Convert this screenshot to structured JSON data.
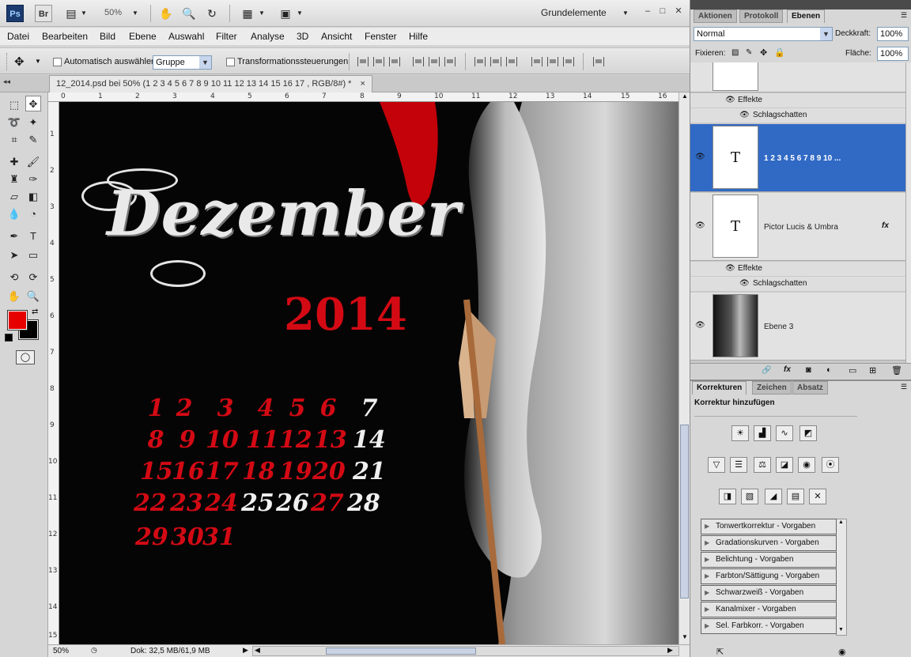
{
  "appbar": {
    "ps_logo": "Ps",
    "br_logo": "Br",
    "zoom": "50%",
    "workspace": "Grundelemente"
  },
  "menu": {
    "items": [
      "Datei",
      "Bearbeiten",
      "Bild",
      "Ebene",
      "Auswahl",
      "Filter",
      "Analyse",
      "3D",
      "Ansicht",
      "Fenster",
      "Hilfe"
    ]
  },
  "options": {
    "auto_select_label": "Automatisch auswählen:",
    "auto_select_value": "Gruppe",
    "transform_label": "Transformationssteuerungen"
  },
  "document": {
    "tab_title": "12_2014.psd bei 50% (1  2   3  4  5  6   7  8  9  10   11  12  13  14  15  16  17 , RGB/8#) *",
    "close": "×"
  },
  "ruler": {
    "top_ticks": [
      "0",
      "1",
      "2",
      "3",
      "4",
      "5",
      "6",
      "7",
      "8",
      "9",
      "10",
      "11",
      "12",
      "13",
      "14",
      "15",
      "16"
    ],
    "left_ticks": [
      "1",
      "2",
      "3",
      "4",
      "5",
      "6",
      "7",
      "8",
      "9",
      "10",
      "11",
      "12",
      "13",
      "14",
      "15"
    ]
  },
  "canvas": {
    "month": "Dezember",
    "year": "2014",
    "days": [
      [
        "1",
        "2",
        "3",
        "4",
        "5",
        "6",
        "7"
      ],
      [
        "8",
        "9",
        "10",
        "11",
        "12",
        "13",
        "14"
      ],
      [
        "15",
        "16",
        "17",
        "18",
        "19",
        "20",
        "21"
      ],
      [
        "22",
        "23",
        "24",
        "25",
        "26",
        "27",
        "28"
      ],
      [
        "29",
        "30",
        "31"
      ]
    ],
    "white_days": [
      "7",
      "14",
      "21",
      "25",
      "26",
      "28"
    ],
    "red_color": "#d30a14"
  },
  "statusbar": {
    "zoom": "50%",
    "doc_info": "Dok: 32,5 MB/61,9 MB"
  },
  "layers_panel": {
    "tabs": [
      "Aktionen",
      "Protokoll",
      "Ebenen"
    ],
    "active_tab": "Ebenen",
    "blend_mode": "Normal",
    "opacity_label": "Deckkraft:",
    "opacity": "100%",
    "fix_label": "Fixieren:",
    "fill_label": "Fläche:",
    "fill": "100%",
    "effects_label": "Effekte",
    "shadow_label": "Schlagschatten",
    "layers": [
      {
        "name": "1  2  3  4 5  6  7  8 9  10  ...",
        "selected": true
      },
      {
        "name": "Pictor Lucis   & Umbra",
        "fx": "fx"
      },
      {
        "name": "Ebene 3"
      }
    ],
    "selected_color": "#316ac5"
  },
  "korrekturen_panel": {
    "tabs": [
      "Korrekturen",
      "Zeichen",
      "Absatz"
    ],
    "heading": "Korrektur hinzufügen",
    "presets": [
      "Tonwertkorrektur - Vorgaben",
      "Gradationskurven - Vorgaben",
      "Belichtung - Vorgaben",
      "Farbton/Sättigung - Vorgaben",
      "Schwarzweiß - Vorgaben",
      "Kanalmixer - Vorgaben",
      "Sel. Farbkorr. - Vorgaben"
    ]
  }
}
